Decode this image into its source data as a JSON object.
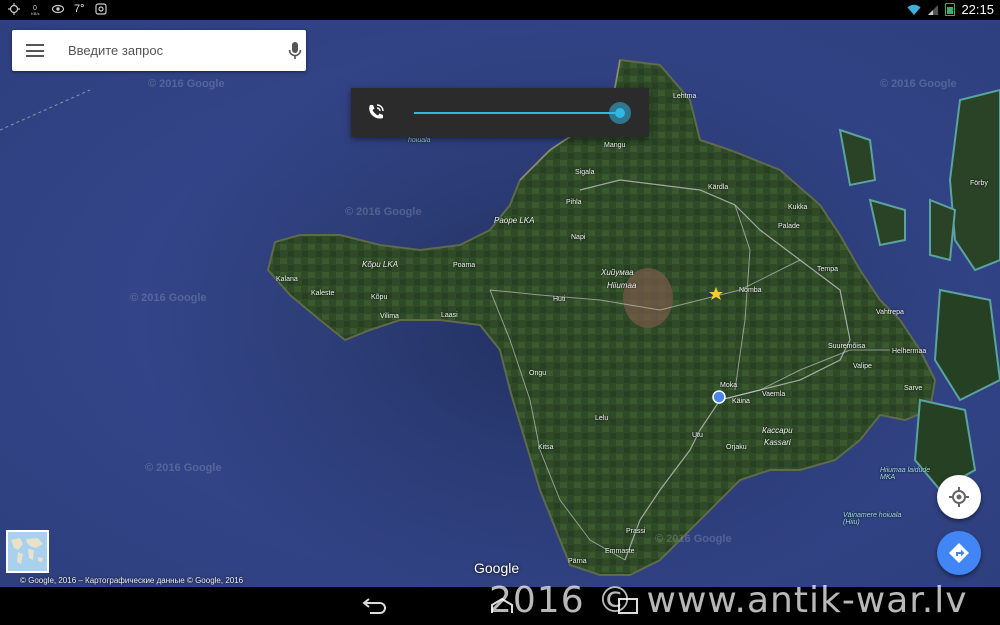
{
  "status_bar": {
    "temperature": "7°",
    "time": "22:15",
    "icons": [
      "gps-icon",
      "data-speed-icon",
      "eye-icon",
      "notification-icon",
      "wifi-icon",
      "signal-icon",
      "battery-icon"
    ]
  },
  "search": {
    "placeholder": "Введите запрос"
  },
  "volume": {
    "level": 0.98,
    "accent_color": "#33b5e5"
  },
  "map": {
    "places": {
      "lehtma": "Lehtma",
      "mangu": "Mangu",
      "sigala": "Sigala",
      "kardla": "Kärdla",
      "kukka": "Kukka",
      "palade": "Palade",
      "fohrby": "Förby",
      "paope_lka": "Paope LKA",
      "pihla": "Pihla",
      "napi": "Napi",
      "kopu_lka": "Kõpu LKA",
      "poama": "Poama",
      "kalana": "Kalana",
      "kaleste": "Kaleste",
      "kopu": "Kõpu",
      "vilima": "Vilima",
      "laasi": "Laasi",
      "hiiumaa_ru": "Хийумаа",
      "hiiumaa": "Hiiumaa",
      "huti": "Huti",
      "nomba": "Nomba",
      "tempa": "Tempa",
      "vahtrepa": "Vahtrepa",
      "suuremoisa": "Suuremõisa",
      "helhermaa": "Helhermaa",
      "valipe": "Valipe",
      "sarve": "Sarve",
      "ongu": "Ongu",
      "moka": "Moka",
      "kaina": "Käina",
      "vaemla": "Vaemla",
      "kassari_ru": "Кассари",
      "kassari": "Kassari",
      "lelu": "Lelu",
      "utu": "Utu",
      "orjaku": "Orjaku",
      "kitsa": "Kitsa",
      "hiiumaa_laidude": "Hiiumaa laidude MKA",
      "vainamere": "Väinamere hoiuala (Hiiu)",
      "prassi": "Prassi",
      "emmaste": "Emmaste",
      "parna": "Pärna",
      "hoiuala_top": "hoiuala"
    },
    "watermark": "© 2016 Google",
    "google_logo": "Google",
    "copyright": "© Google, 2016 – Картографические данные © Google, 2016"
  },
  "site_watermark": "2016 © www.antik-war.lv",
  "colors": {
    "water": "#34468a",
    "land": "#2f4a2a",
    "location_dot": "#4a86e8",
    "direction_button": "#4285f4"
  }
}
